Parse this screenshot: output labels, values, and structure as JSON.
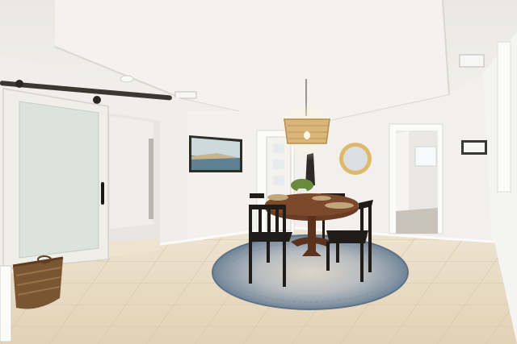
{
  "scene": {
    "kind": "photograph",
    "subject": "dining room",
    "palette": {
      "ceiling": "#ecebe6",
      "tray_ceiling": "#f2f1ed",
      "wall": "#f1f0ed",
      "trim": "#fbfbf9",
      "floor_tile": "#e6d8c0",
      "grout": "#d5c5aa",
      "barn_door_frame": "#efeee8",
      "frosted_glass": "#dbe4dc",
      "barn_rail": "#3b3731",
      "table_wood": "#6a3c24",
      "chair_black": "#1f1c1a",
      "rug_blue": "#7d8fa0",
      "rug_cream": "#e3ddd0",
      "pendant_rattan": "#d9b77a",
      "artwork_blue": "#5f7f93",
      "basket_brown": "#7a5532"
    }
  }
}
